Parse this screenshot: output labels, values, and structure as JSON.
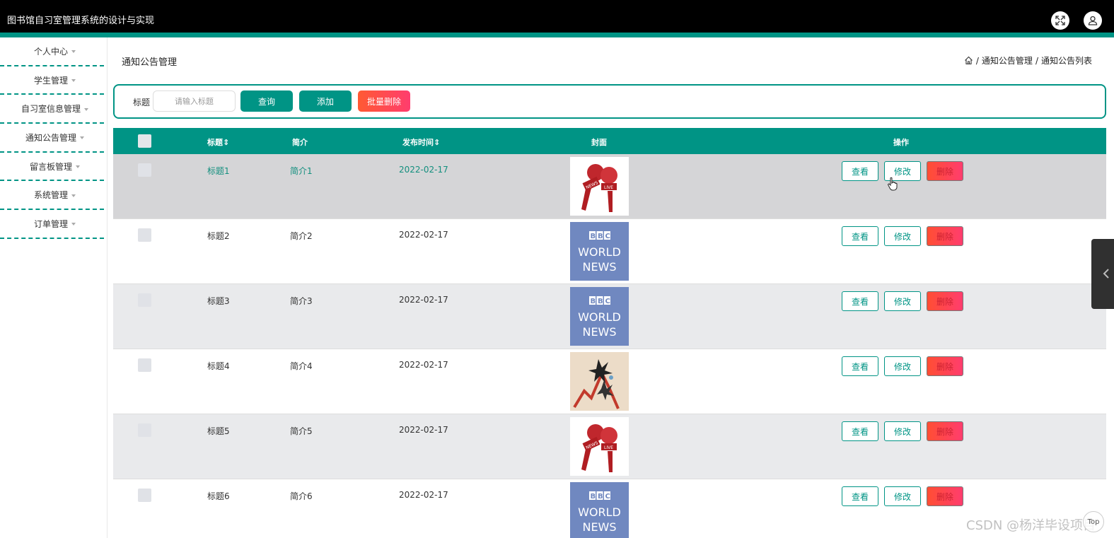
{
  "app": {
    "title": "图书馆自习室管理系统的设计与实现"
  },
  "sidebar": {
    "items": [
      {
        "label": "个人中心"
      },
      {
        "label": "学生管理"
      },
      {
        "label": "自习室信息管理"
      },
      {
        "label": "通知公告管理"
      },
      {
        "label": "留言板管理"
      },
      {
        "label": "系统管理"
      },
      {
        "label": "订单管理"
      }
    ]
  },
  "page": {
    "title": "通知公告管理",
    "breadcrumb": [
      "通知公告管理",
      "通知公告列表"
    ],
    "breadcrumb_sep": "/"
  },
  "search": {
    "label": "标题",
    "placeholder": "请输入标题",
    "query_btn": "查询",
    "add_btn": "添加",
    "batch_delete_btn": "批量删除"
  },
  "table": {
    "headers": {
      "title": "标题",
      "intro": "简介",
      "date": "发布时间",
      "cover": "封面",
      "actions": "操作"
    },
    "sort_glyph": "⇕",
    "action_labels": {
      "view": "查看",
      "edit": "修改",
      "delete": "删除"
    },
    "rows": [
      {
        "title": "标题1",
        "intro": "简介1",
        "date": "2022-02-17",
        "cover": "news-mic-icon"
      },
      {
        "title": "标题2",
        "intro": "简介2",
        "date": "2022-02-17",
        "cover": "bbc-world-news"
      },
      {
        "title": "标题3",
        "intro": "简介3",
        "date": "2022-02-17",
        "cover": "bbc-world-news"
      },
      {
        "title": "标题4",
        "intro": "简介4",
        "date": "2022-02-17",
        "cover": "chart-crash-image"
      },
      {
        "title": "标题5",
        "intro": "简介5",
        "date": "2022-02-17",
        "cover": "news-mic-icon"
      },
      {
        "title": "标题6",
        "intro": "简介6",
        "date": "2022-02-17",
        "cover": "bbc-world-news"
      }
    ]
  },
  "cover_text": {
    "bbc": [
      "B",
      "B",
      "C"
    ],
    "world": "WORLD",
    "news": "NEWS",
    "mic_news": "NEWS",
    "mic_live": "LIVE"
  },
  "overlay": {
    "watermark": "CSDN @杨洋毕设项目",
    "top_button": "Top"
  },
  "colors": {
    "accent": "#009485",
    "danger": "#ff4e33",
    "topbar": "#000000",
    "hover_row": "#d5d5d7",
    "alt_row": "#e9eaec"
  }
}
